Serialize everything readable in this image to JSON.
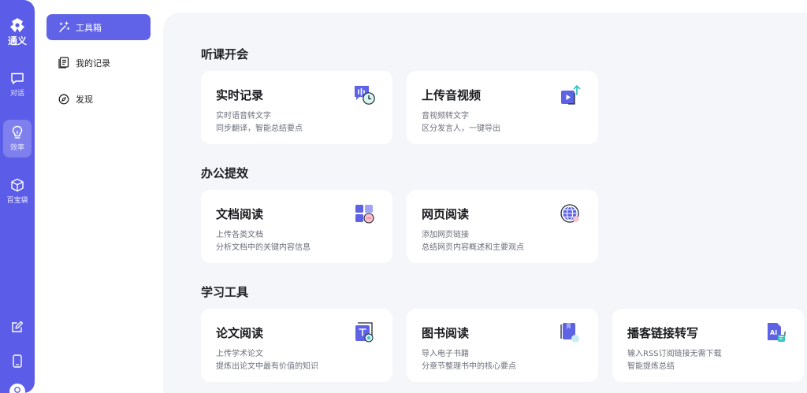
{
  "rail": {
    "logo_text": "通义",
    "items": [
      {
        "label": "对话",
        "icon": "chat-icon"
      },
      {
        "label": "效率",
        "icon": "lightbulb-icon"
      },
      {
        "label": "百宝袋",
        "icon": "cube-icon"
      }
    ],
    "bottom_icons": [
      "edit-icon",
      "mobile-icon",
      "avatar-icon"
    ]
  },
  "nav": {
    "items": [
      {
        "label": "工具箱",
        "icon": "magic-wand-icon",
        "active": true
      },
      {
        "label": "我的记录",
        "icon": "records-icon",
        "active": false
      },
      {
        "label": "发现",
        "icon": "compass-icon",
        "active": false
      }
    ]
  },
  "sections": [
    {
      "title": "听课开会",
      "cards": [
        {
          "title": "实时记录",
          "desc1": "实时语音转文字",
          "desc2": "同步翻译，智能总结要点",
          "icon": "realtime-record-icon"
        },
        {
          "title": "上传音视频",
          "desc1": "音视频转文字",
          "desc2": "区分发言人，一键导出",
          "icon": "upload-video-icon"
        }
      ]
    },
    {
      "title": "办公提效",
      "cards": [
        {
          "title": "文档阅读",
          "desc1": "上传各类文档",
          "desc2": "分析文档中的关键内容信息",
          "icon": "document-read-icon"
        },
        {
          "title": "网页阅读",
          "desc1": "添加网页链接",
          "desc2": "总结网页内容概述和主要观点",
          "icon": "web-read-icon"
        }
      ]
    },
    {
      "title": "学习工具",
      "cards": [
        {
          "title": "论文阅读",
          "desc1": "上传学术论文",
          "desc2": "提炼出论文中最有价值的知识",
          "icon": "paper-read-icon"
        },
        {
          "title": "图书阅读",
          "desc1": "导入电子书籍",
          "desc2": "分章节整理书中的核心要点",
          "icon": "book-read-icon"
        },
        {
          "title": "播客链接转写",
          "desc1": "输入RSS订阅链接无需下载",
          "desc2": "智能提炼总结",
          "icon": "podcast-ai-icon",
          "icon_text": "AI"
        }
      ]
    }
  ],
  "colors": {
    "accent": "#6063e8",
    "rail": "#5b5de8",
    "panel": "#f5f6fa",
    "icon_primary": "#5e63e6",
    "icon_secondary": "#9fa4f5",
    "icon_teal": "#3ec6c0",
    "icon_pink": "#f1738c"
  }
}
